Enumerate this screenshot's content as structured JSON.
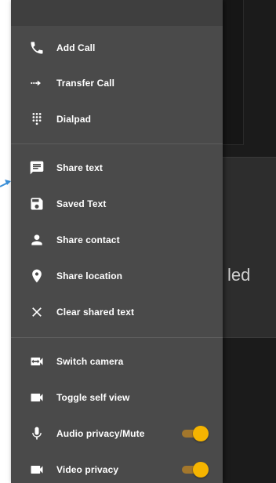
{
  "background": {
    "partial_text": "led"
  },
  "menu": {
    "groups": [
      {
        "items": [
          {
            "label": "Add Call",
            "icon": "phone-icon"
          },
          {
            "label": "Transfer Call",
            "icon": "transfer-icon"
          },
          {
            "label": "Dialpad",
            "icon": "dialpad-icon"
          }
        ]
      },
      {
        "items": [
          {
            "label": "Share text",
            "icon": "message-icon"
          },
          {
            "label": "Saved Text",
            "icon": "save-icon"
          },
          {
            "label": "Share contact",
            "icon": "person-icon"
          },
          {
            "label": "Share location",
            "icon": "location-pin-icon"
          },
          {
            "label": "Clear shared text",
            "icon": "close-icon"
          }
        ]
      },
      {
        "items": [
          {
            "label": "Switch camera",
            "icon": "switch-camera-icon"
          },
          {
            "label": "Toggle self view",
            "icon": "videocam-icon"
          },
          {
            "label": "Audio privacy/Mute",
            "icon": "microphone-icon",
            "toggle_on": true
          },
          {
            "label": "Video privacy",
            "icon": "videocam-icon",
            "toggle_on": true
          }
        ]
      }
    ]
  },
  "colors": {
    "drawer_bg": "#4a4a4a",
    "toggle_thumb": "#f5b400",
    "toggle_track": "#a3772c",
    "pointer": "#3a8fd8"
  }
}
